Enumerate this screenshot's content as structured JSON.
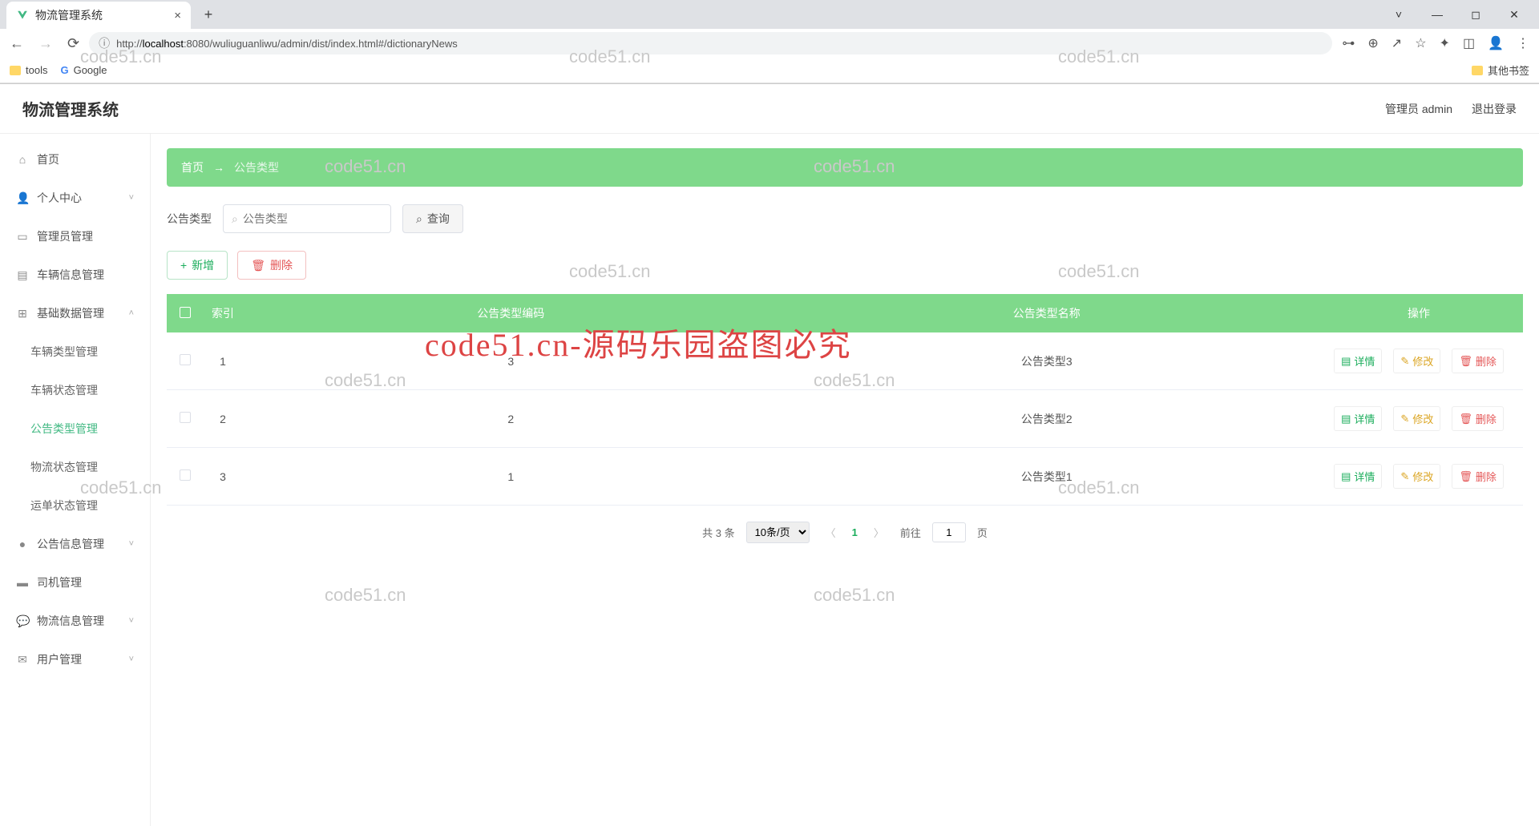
{
  "browser": {
    "tab_title": "物流管理系统",
    "url_prefix": "http://",
    "url_host": "localhost",
    "url_rest": ":8080/wuliuguanliwu/admin/dist/index.html#/dictionaryNews",
    "bookmarks": {
      "tools": "tools",
      "google": "Google",
      "other": "其他书签"
    }
  },
  "header": {
    "title": "物流管理系统",
    "user": "管理员 admin",
    "logout": "退出登录"
  },
  "sidebar": {
    "items": [
      {
        "icon": "⌂",
        "label": "首页",
        "chev": ""
      },
      {
        "icon": "👤",
        "label": "个人中心",
        "chev": "˅"
      },
      {
        "icon": "▭",
        "label": "管理员管理",
        "chev": ""
      },
      {
        "icon": "▤",
        "label": "车辆信息管理",
        "chev": ""
      },
      {
        "icon": "⊞",
        "label": "基础数据管理",
        "chev": "˄"
      },
      {
        "icon": "●",
        "label": "公告信息管理",
        "chev": "˅"
      },
      {
        "icon": "▬",
        "label": "司机管理",
        "chev": ""
      },
      {
        "icon": "💬",
        "label": "物流信息管理",
        "chev": "˅"
      },
      {
        "icon": "✉",
        "label": "用户管理",
        "chev": "˅"
      }
    ],
    "subs": [
      "车辆类型管理",
      "车辆状态管理",
      "公告类型管理",
      "物流状态管理",
      "运单状态管理"
    ],
    "active_sub": "公告类型管理"
  },
  "breadcrumb": {
    "home": "首页",
    "arrow": "→",
    "current": "公告类型"
  },
  "filter": {
    "label": "公告类型",
    "placeholder": "公告类型",
    "search": "查询"
  },
  "actions": {
    "add": "新增",
    "delete": "删除"
  },
  "table": {
    "headers": [
      "",
      "索引",
      "公告类型编码",
      "公告类型名称",
      "操作"
    ],
    "rows": [
      {
        "index": "1",
        "code": "3",
        "name": "公告类型3"
      },
      {
        "index": "2",
        "code": "2",
        "name": "公告类型2"
      },
      {
        "index": "3",
        "code": "1",
        "name": "公告类型1"
      }
    ],
    "row_actions": {
      "detail": "详情",
      "edit": "修改",
      "delete": "删除"
    }
  },
  "pager": {
    "total": "共 3 条",
    "per_page": "10条/页",
    "current": "1",
    "goto_pre": "前往",
    "goto_suf": "页",
    "goto_val": "1"
  },
  "watermark": "code51.cn",
  "big_watermark": "code51.cn-源码乐园盗图必究"
}
